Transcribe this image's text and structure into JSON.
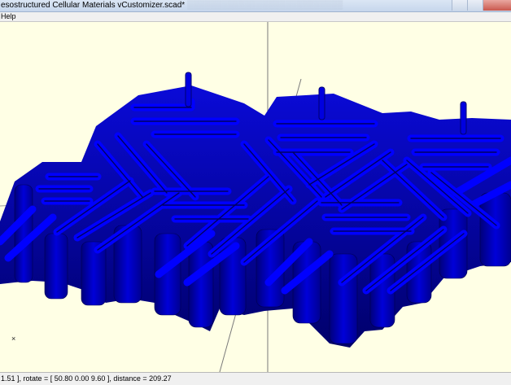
{
  "window": {
    "title": "esostructured Cellular Materials vCustomizer.scad*"
  },
  "menubar": {
    "items": [
      {
        "label": "Help"
      }
    ]
  },
  "viewport": {
    "model_color": "#0000ff",
    "background_color": "#ffffe5",
    "axis_marker": "×"
  },
  "statusbar": {
    "text": "1.51 ], rotate = [ 50.80 0.00 9.60 ], distance = 209.27"
  }
}
